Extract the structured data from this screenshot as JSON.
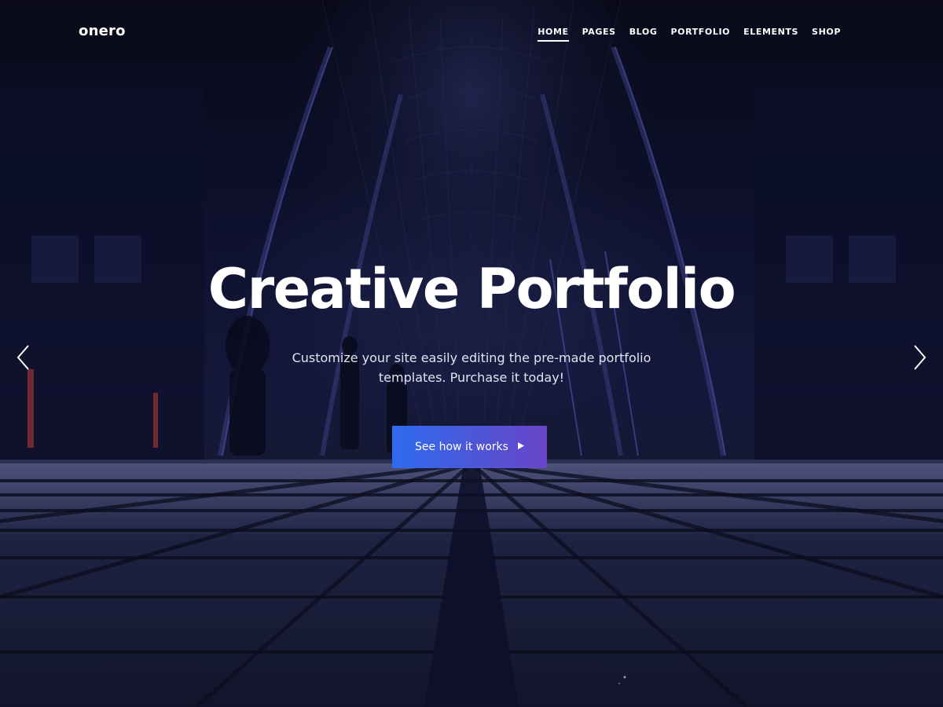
{
  "header": {
    "logo": "onero",
    "nav": [
      {
        "label": "HOME",
        "active": true
      },
      {
        "label": "PAGES",
        "active": false
      },
      {
        "label": "BLOG",
        "active": false
      },
      {
        "label": "PORTFOLIO",
        "active": false
      },
      {
        "label": "ELEMENTS",
        "active": false
      },
      {
        "label": "SHOP",
        "active": false
      }
    ]
  },
  "hero": {
    "title": "Creative Portfolio",
    "subtitle": "Customize your site easily editing the pre-made portfolio templates. Purchase it today!",
    "cta_label": "See how it works",
    "cta_icon": "play-triangle-icon",
    "prev_icon": "chevron-left-icon",
    "next_icon": "chevron-right-icon"
  },
  "colors": {
    "cta_gradient_start": "#2f6bf0",
    "cta_gradient_end": "#6944c8",
    "text": "#ffffff"
  }
}
